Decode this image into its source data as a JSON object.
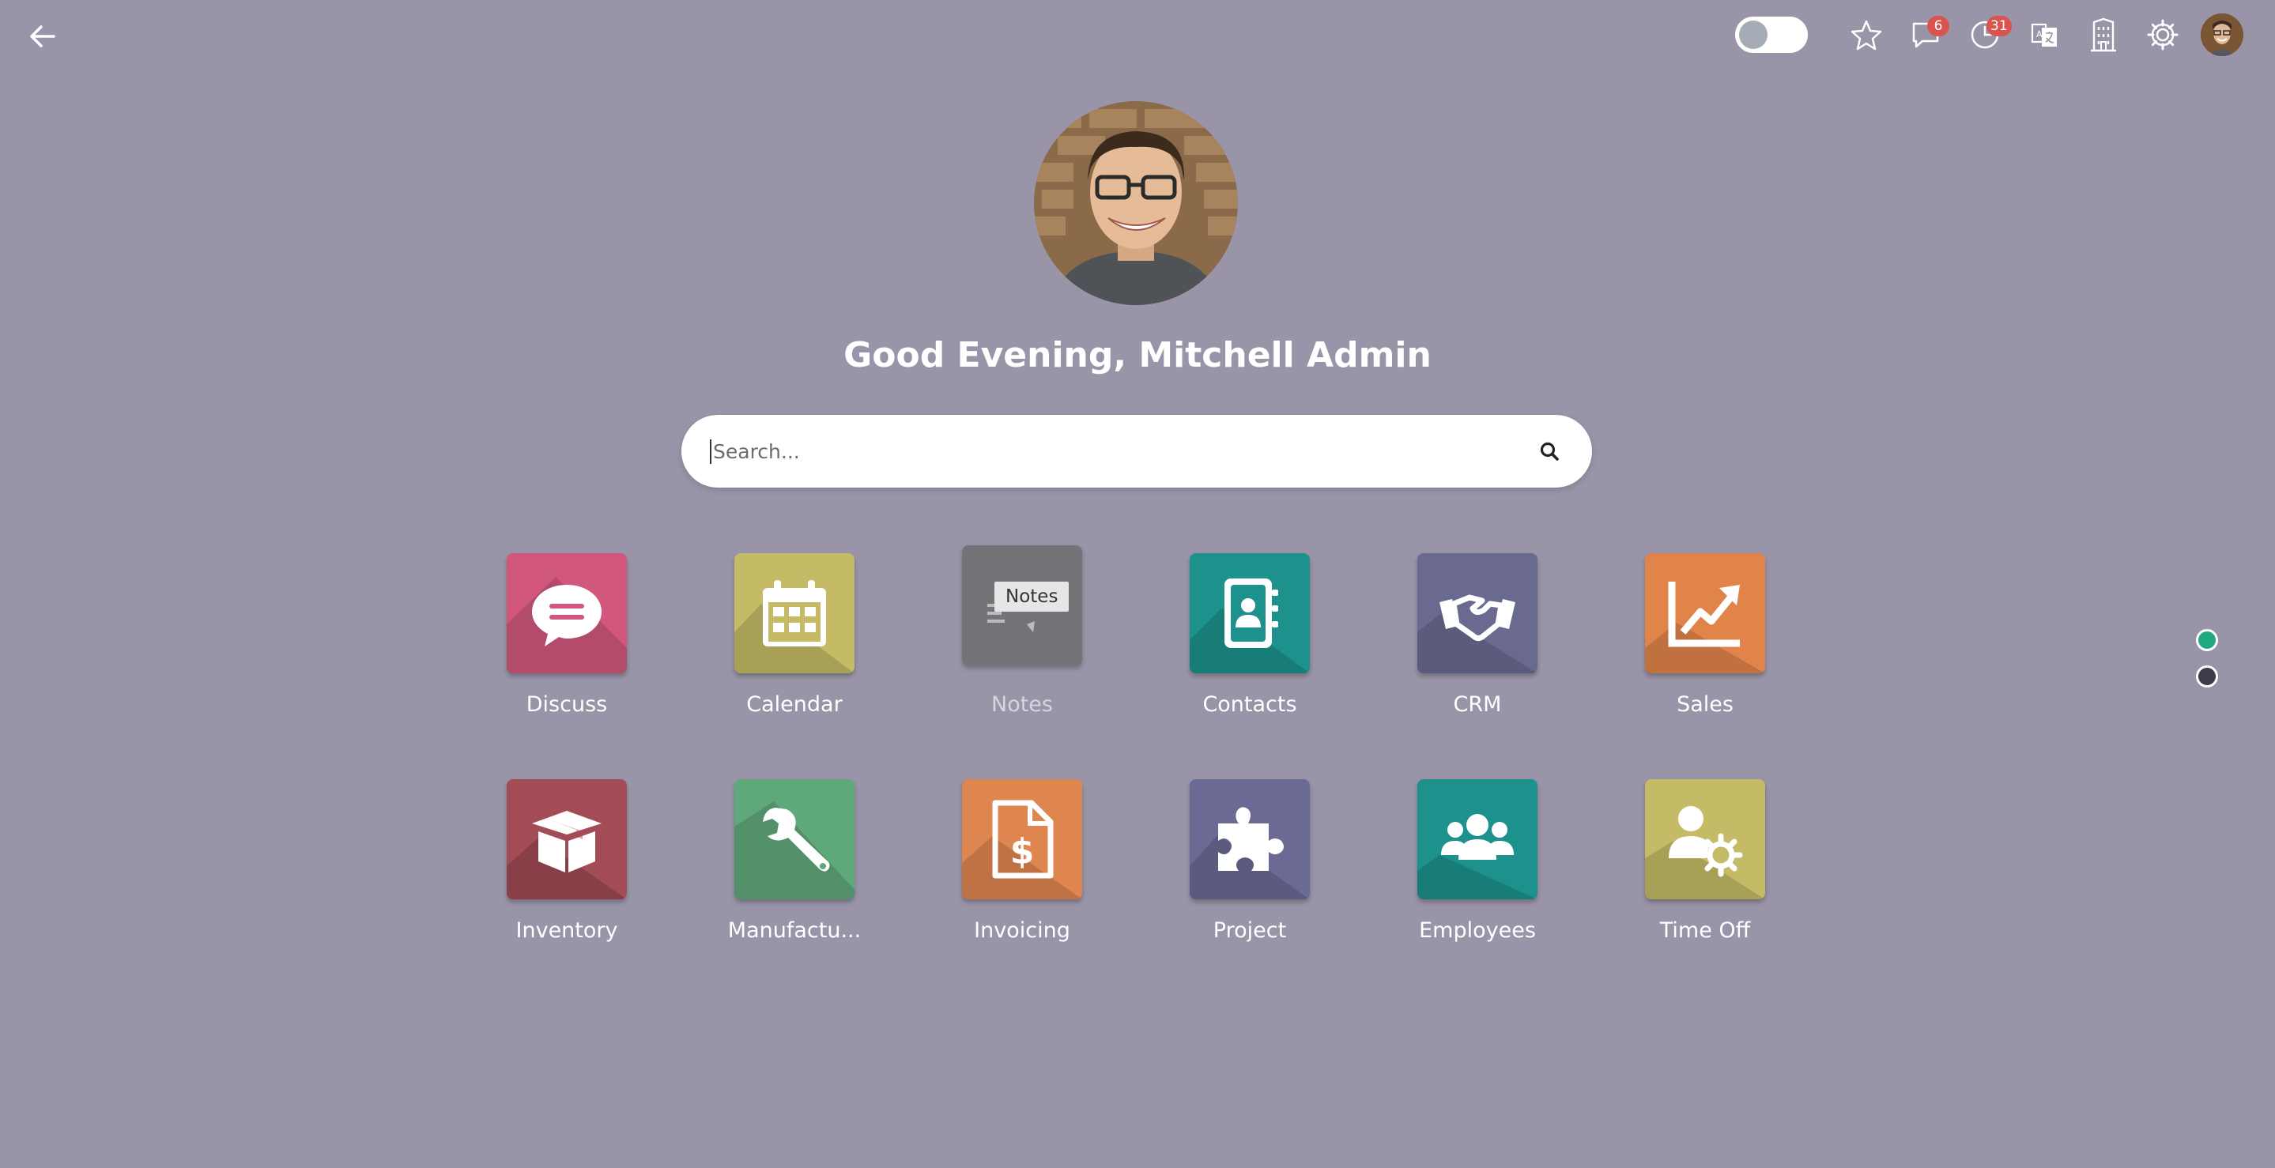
{
  "topbar": {
    "chat_badge": "6",
    "activity_badge": "31"
  },
  "greeting": "Good Evening, Mitchell Admin",
  "search": {
    "placeholder": "Search...",
    "value": ""
  },
  "tooltip": "Notes",
  "apps": [
    {
      "label": "Discuss",
      "color": "#d1587c",
      "icon": "speech-bubble-icon"
    },
    {
      "label": "Calendar",
      "color": "#c5bb66",
      "icon": "calendar-icon"
    },
    {
      "label": "Notes",
      "color": "#767378",
      "icon": "notes-icon"
    },
    {
      "label": "Contacts",
      "color": "#1d918b",
      "icon": "address-book-icon"
    },
    {
      "label": "CRM",
      "color": "#6a6a91",
      "icon": "handshake-icon"
    },
    {
      "label": "Sales",
      "color": "#e0844a",
      "icon": "trend-chart-icon"
    },
    {
      "label": "Inventory",
      "color": "#a34c55",
      "icon": "box-icon"
    },
    {
      "label": "Manufactu...",
      "color": "#5fa87a",
      "icon": "wrench-icon"
    },
    {
      "label": "Invoicing",
      "color": "#df8650",
      "icon": "invoice-dollar-icon"
    },
    {
      "label": "Project",
      "color": "#6b6a94",
      "icon": "puzzle-icon"
    },
    {
      "label": "Employees",
      "color": "#1d918b",
      "icon": "people-icon"
    },
    {
      "label": "Time Off",
      "color": "#c5bb66",
      "icon": "user-gear-icon"
    }
  ],
  "pager": {
    "active_color": "#20a980",
    "inactive_color": "#3d3c48"
  }
}
